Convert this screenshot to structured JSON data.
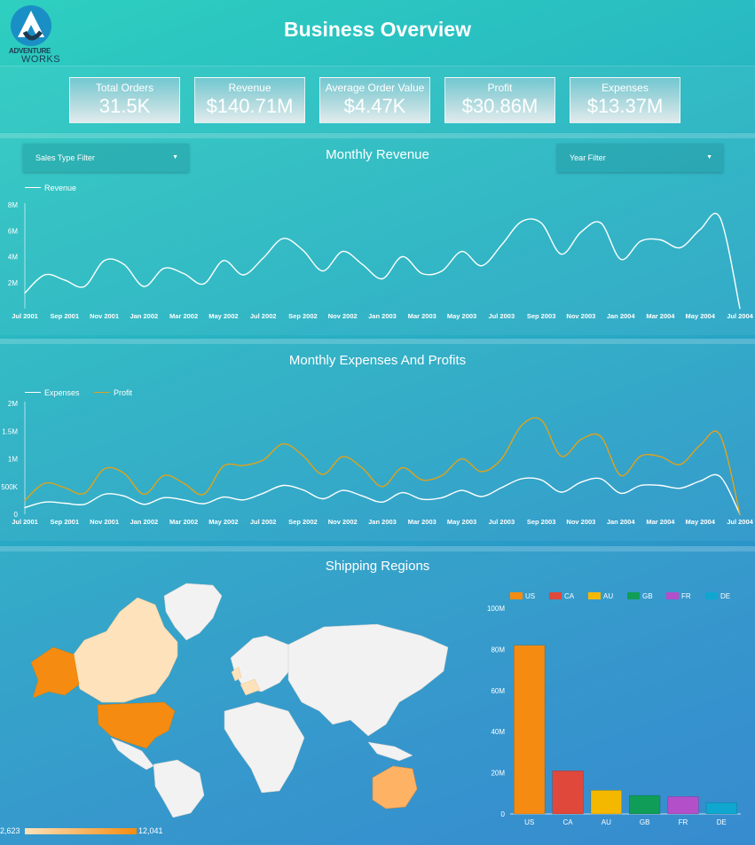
{
  "header": {
    "title": "Business Overview",
    "logo_line1": "ADVENTURE",
    "logo_line2": "WORKS"
  },
  "kpis": [
    {
      "label": "Total Orders",
      "value": "31.5K"
    },
    {
      "label": "Revenue",
      "value": "$140.71M"
    },
    {
      "label": "Average Order Value",
      "value": "$4.47K"
    },
    {
      "label": "Profit",
      "value": "$30.86M"
    },
    {
      "label": "Expenses",
      "value": "$13.37M"
    }
  ],
  "filters": {
    "sales_type": "Sales Type Filter",
    "year": "Year Filter"
  },
  "colors": {
    "revenue": "#ffffff",
    "expenses": "#ffffff",
    "profit": "#e0a21a",
    "map_high": "#f58c11",
    "map_low": "#fde2bc",
    "map_none": "#f2f2f2"
  },
  "map": {
    "title": "Shipping Regions",
    "scale_min": "2,623",
    "scale_max": "12,041"
  },
  "chart_data": [
    {
      "type": "line",
      "title": "Monthly Revenue",
      "x": [
        "Jul 2001",
        "Aug 2001",
        "Sep 2001",
        "Oct 2001",
        "Nov 2001",
        "Dec 2001",
        "Jan 2002",
        "Feb 2002",
        "Mar 2002",
        "Apr 2002",
        "May 2002",
        "Jun 2002",
        "Jul 2002",
        "Aug 2002",
        "Sep 2002",
        "Oct 2002",
        "Nov 2002",
        "Dec 2002",
        "Jan 2003",
        "Feb 2003",
        "Mar 2003",
        "Apr 2003",
        "May 2003",
        "Jun 2003",
        "Jul 2003",
        "Aug 2003",
        "Sep 2003",
        "Oct 2003",
        "Nov 2003",
        "Dec 2003",
        "Jan 2004",
        "Feb 2004",
        "Mar 2004",
        "Apr 2004",
        "May 2004",
        "Jun 2004",
        "Jul 2004"
      ],
      "x_ticks": [
        "Jul 2001",
        "Sep 2001",
        "Nov 2001",
        "Jan 2002",
        "Mar 2002",
        "May 2002",
        "Jul 2002",
        "Sep 2002",
        "Nov 2002",
        "Jan 2003",
        "Mar 2003",
        "May 2003",
        "Jul 2003",
        "Sep 2003",
        "Nov 2003",
        "Jan 2004",
        "Mar 2004",
        "May 2004",
        "Jul 2004"
      ],
      "series": [
        {
          "name": "Revenue",
          "values": [
            1.2,
            2.6,
            2.2,
            1.7,
            3.7,
            3.4,
            1.7,
            3.1,
            2.7,
            1.9,
            3.7,
            2.6,
            3.9,
            5.4,
            4.5,
            2.9,
            4.4,
            3.4,
            2.3,
            4.0,
            2.7,
            2.9,
            4.4,
            3.3,
            4.9,
            6.7,
            6.6,
            4.2,
            5.9,
            6.6,
            3.8,
            5.2,
            5.3,
            4.7,
            6.1,
            7.0,
            0.0
          ]
        }
      ],
      "y_ticks": [
        "8M",
        "6M",
        "4M",
        "2M"
      ],
      "ylim": [
        0,
        8
      ]
    },
    {
      "type": "line",
      "title": "Monthly Expenses And Profits",
      "x": [
        "Jul 2001",
        "Aug 2001",
        "Sep 2001",
        "Oct 2001",
        "Nov 2001",
        "Dec 2001",
        "Jan 2002",
        "Feb 2002",
        "Mar 2002",
        "Apr 2002",
        "May 2002",
        "Jun 2002",
        "Jul 2002",
        "Aug 2002",
        "Sep 2002",
        "Oct 2002",
        "Nov 2002",
        "Dec 2002",
        "Jan 2003",
        "Feb 2003",
        "Mar 2003",
        "Apr 2003",
        "May 2003",
        "Jun 2003",
        "Jul 2003",
        "Aug 2003",
        "Sep 2003",
        "Oct 2003",
        "Nov 2003",
        "Dec 2003",
        "Jan 2004",
        "Feb 2004",
        "Mar 2004",
        "Apr 2004",
        "May 2004",
        "Jun 2004",
        "Jul 2004"
      ],
      "x_ticks": [
        "Jul 2001",
        "Sep 2001",
        "Nov 2001",
        "Jan 2002",
        "Mar 2002",
        "May 2002",
        "Jul 2002",
        "Sep 2002",
        "Nov 2002",
        "Jan 2003",
        "Mar 2003",
        "May 2003",
        "Jul 2003",
        "Sep 2003",
        "Nov 2003",
        "Jan 2004",
        "Mar 2004",
        "May 2004",
        "Jul 2004"
      ],
      "series": [
        {
          "name": "Expenses",
          "values": [
            120,
            220,
            200,
            180,
            360,
            330,
            180,
            300,
            260,
            190,
            310,
            260,
            380,
            520,
            440,
            280,
            430,
            330,
            220,
            390,
            270,
            300,
            430,
            320,
            480,
            640,
            620,
            400,
            580,
            640,
            380,
            520,
            520,
            470,
            600,
            680,
            0
          ]
        },
        {
          "name": "Profit",
          "values": [
            250,
            560,
            480,
            380,
            820,
            740,
            360,
            700,
            560,
            360,
            870,
            880,
            980,
            1270,
            1060,
            720,
            1040,
            830,
            500,
            840,
            620,
            700,
            1000,
            770,
            1000,
            1600,
            1700,
            1050,
            1350,
            1400,
            700,
            1050,
            1040,
            900,
            1250,
            1430,
            0
          ]
        }
      ],
      "y_ticks": [
        "2M",
        "1.5M",
        "1M",
        "500K",
        "0"
      ],
      "ylim": [
        0,
        2000
      ]
    },
    {
      "type": "bar",
      "categories": [
        "US",
        "CA",
        "AU",
        "GB",
        "FR",
        "DE"
      ],
      "values": [
        82,
        21,
        11.5,
        9,
        8.5,
        5.5
      ],
      "colors": [
        "#f58c11",
        "#e0483c",
        "#f5b800",
        "#109d58",
        "#b24fc9",
        "#0fa7cf"
      ],
      "y_ticks": [
        "100M",
        "80M",
        "60M",
        "40M",
        "20M",
        "0"
      ],
      "ylim": [
        0,
        100
      ]
    }
  ]
}
